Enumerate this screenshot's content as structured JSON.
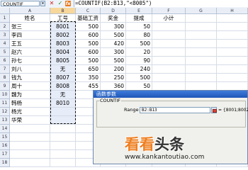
{
  "formula_bar": {
    "name_box": "COUNTIF",
    "cancel_glyph": "✕",
    "enter_glyph": "✓",
    "fx_glyph": "fx",
    "formula": "=COUNTIF(B2:B13,\"<8005\")"
  },
  "columns": [
    "A",
    "B",
    "C",
    "D",
    "E",
    "F",
    "G",
    "H"
  ],
  "rows": [
    [
      "姓名",
      "工号",
      "基础工资",
      "奖金",
      "提成",
      "小计"
    ],
    [
      "张三",
      "8001",
      "500",
      "300",
      "50",
      ""
    ],
    [
      "李四",
      "8002",
      "600",
      "500",
      "80",
      ""
    ],
    [
      "王五",
      "8003",
      "500",
      "420",
      "500",
      ""
    ],
    [
      "赵六",
      "8004",
      "600",
      "300",
      "20",
      ""
    ],
    [
      "孙七",
      "8005",
      "500",
      "500",
      "90",
      ""
    ],
    [
      "刘八",
      "无",
      "650",
      "200",
      "240",
      ""
    ],
    [
      "钱九",
      "8007",
      "350",
      "250",
      "500",
      ""
    ],
    [
      "周十",
      "8008",
      "455",
      "360",
      "50",
      ""
    ],
    [
      "魏为",
      "无",
      "",
      "",
      "",
      ""
    ],
    [
      "韩杨",
      "8010",
      "",
      "",
      "",
      ""
    ],
    [
      "杨光",
      "",
      "",
      "",
      "",
      ""
    ],
    [
      "华荣",
      "",
      "",
      "",
      "",
      ""
    ],
    [
      "",
      "",
      "",
      "",
      "",
      ""
    ],
    [
      "",
      "",
      "",
      "",
      "",
      ""
    ],
    [
      "",
      "",
      "",
      "",
      "",
      ""
    ],
    [
      "",
      "",
      "",
      "",
      "",
      ""
    ],
    [
      "",
      "",
      "",
      "",
      "",
      ""
    ]
  ],
  "row_numbers": [
    "1",
    "2",
    "3",
    "4",
    "5",
    "6",
    "7",
    "8",
    "9",
    "10",
    "11",
    "12",
    "13",
    "14",
    "15",
    "16",
    "17",
    "18"
  ],
  "dialog": {
    "title": "函数参数",
    "group_label": "COUNTIF",
    "arg_label": "Range",
    "arg_value": "B2:B13",
    "arg_result": "= {8001;8002;..."
  },
  "watermark": {
    "main_orange": "看看",
    "main_dark": "头条",
    "url": "www.kankantoutiao.com"
  },
  "colors": {
    "header_bg": "#e9eef6",
    "selected_header": "#f7d79b",
    "dialog_title": "#1d56b8",
    "watermark_orange": "#ee7f21"
  }
}
